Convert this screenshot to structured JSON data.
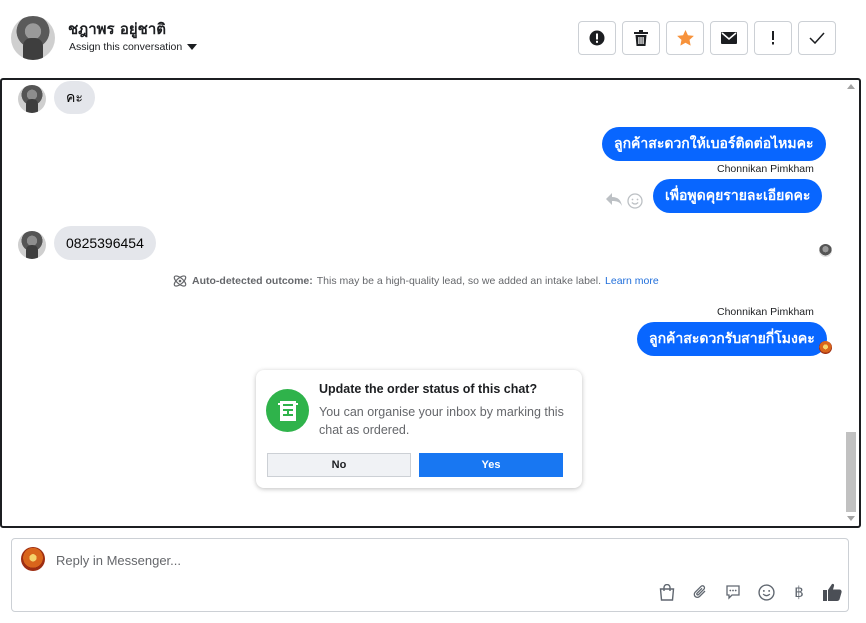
{
  "header": {
    "contact_name": "ชฎาพร อยู่ชาติ",
    "assign_label": "Assign this conversation",
    "actions": [
      {
        "name": "mark-spam-button",
        "icon": "alert-circle-icon"
      },
      {
        "name": "delete-button",
        "icon": "trash-icon"
      },
      {
        "name": "star-button",
        "icon": "star-icon"
      },
      {
        "name": "mark-unread-button",
        "icon": "envelope-icon"
      },
      {
        "name": "follow-up-button",
        "icon": "exclamation-icon"
      },
      {
        "name": "mark-done-button",
        "icon": "check-icon"
      }
    ]
  },
  "conversation": {
    "messages": {
      "m1": "คะ",
      "m2": "ลูกค้าสะดวกให้เบอร์ติดต่อไหมคะ",
      "m2_sender": "Chonnikan Pimkham",
      "m3": "เพื่อพูดคุยรายละเอียดคะ",
      "m4": "0825396454",
      "m5_sender": "Chonnikan Pimkham",
      "m5": "ลูกค้าสะดวกรับสายกี่โมงคะ"
    },
    "outcome": {
      "label": "Auto-detected outcome:",
      "text": "This may be a high-quality lead, so we added an intake label.",
      "link": "Learn more"
    }
  },
  "order_card": {
    "title": "Update the order status of this chat?",
    "body": "You can organise your inbox by marking this chat as ordered.",
    "no_label": "No",
    "yes_label": "Yes"
  },
  "composer": {
    "placeholder": "Reply in Messenger...",
    "currency_symbol": "฿"
  },
  "colors": {
    "accent": "#0866ff",
    "star": "#f7923b",
    "card_icon": "#2fb34b"
  }
}
